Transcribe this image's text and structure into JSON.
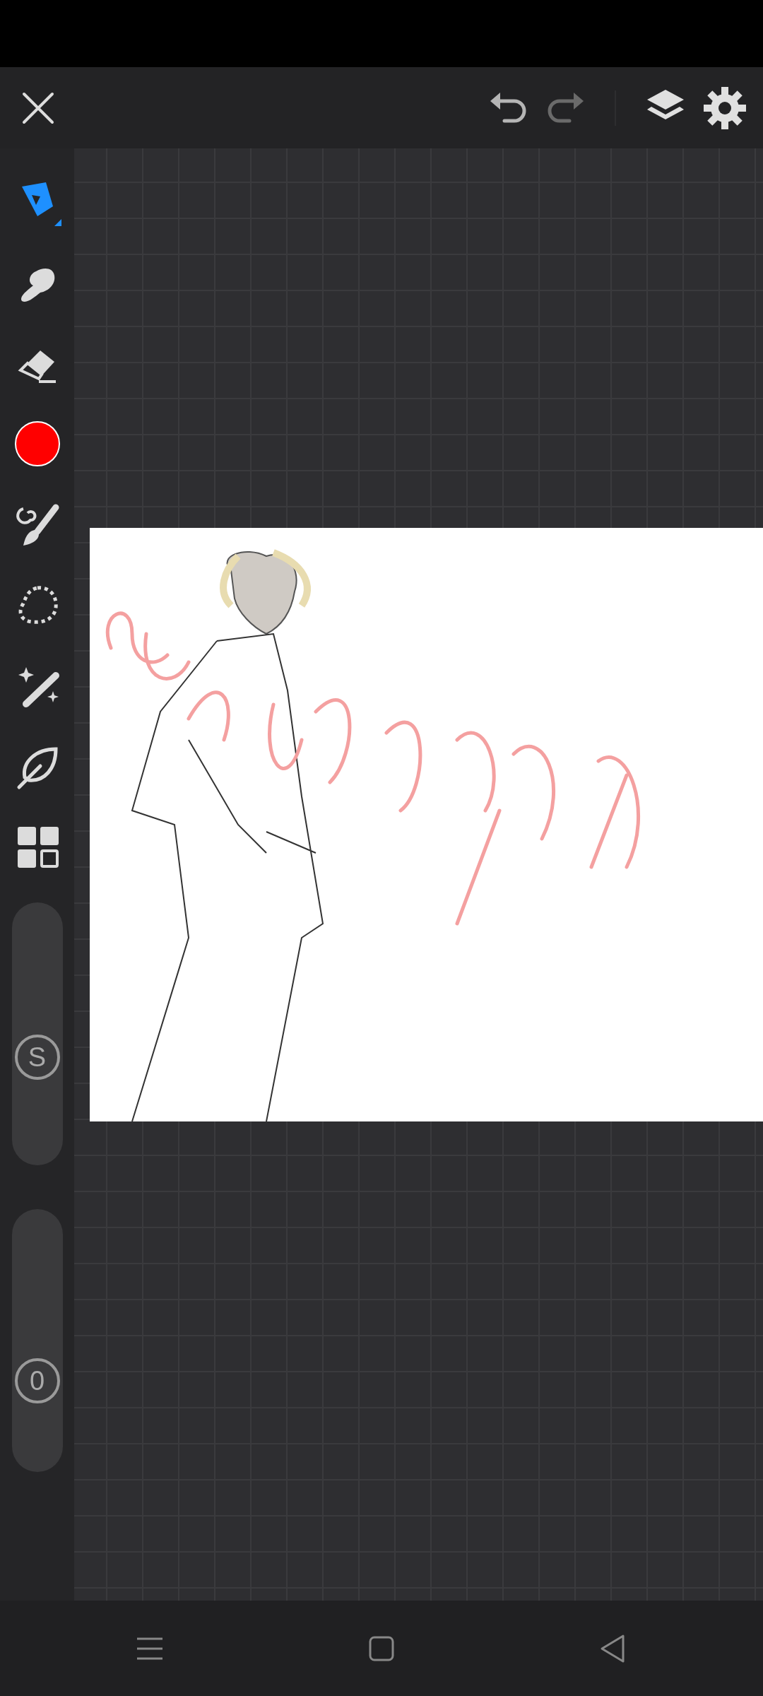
{
  "top_bar": {
    "undo": {
      "disabled": false
    },
    "redo": {
      "disabled": true
    }
  },
  "tools": [
    {
      "kind": "pen",
      "selected": true
    },
    {
      "kind": "smudge",
      "selected": false
    },
    {
      "kind": "eraser",
      "selected": false
    },
    {
      "kind": "color",
      "selected": false,
      "color": "#ff0000"
    },
    {
      "kind": "brush",
      "selected": false
    },
    {
      "kind": "lasso",
      "selected": false
    },
    {
      "kind": "wand",
      "selected": false
    },
    {
      "kind": "leaf",
      "selected": false
    },
    {
      "kind": "grid",
      "selected": false
    }
  ],
  "sliders": [
    {
      "label": "S",
      "level": 0.39
    },
    {
      "label": "0",
      "level": 0.31
    }
  ],
  "nav_bar": [
    {
      "kind": "menu"
    },
    {
      "kind": "home"
    },
    {
      "kind": "back"
    }
  ]
}
